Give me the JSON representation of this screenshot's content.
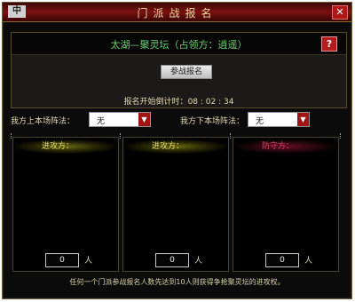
{
  "window": {
    "title": "门派战报名",
    "logo_text": "中",
    "close_label": "✕",
    "colors": {
      "titlebar": "#7a1010",
      "accent_red": "#b31c1c",
      "location_green": "#6ad070"
    }
  },
  "header": {
    "location": "太湖—聚灵坛（占领方：逍遥）",
    "help_label": "?",
    "signup_button": "参战报名",
    "countdown_label": "报名开始倒计时：",
    "countdown_value": "08 : 02 : 34"
  },
  "formation": {
    "current_label": "我方上本场阵法：",
    "current_value": "无",
    "next_label": "我方下本场阵法：",
    "next_value": "无"
  },
  "columns": [
    {
      "title": "进攻方：",
      "count": "0",
      "unit": "人"
    },
    {
      "title": "进攻方：",
      "count": "0",
      "unit": "人"
    },
    {
      "title": "防守方：",
      "count": "0",
      "unit": "人"
    }
  ],
  "footer": "任何一个门派参战报名人数先达到10人则获得争抢聚灵坛的进攻权。"
}
